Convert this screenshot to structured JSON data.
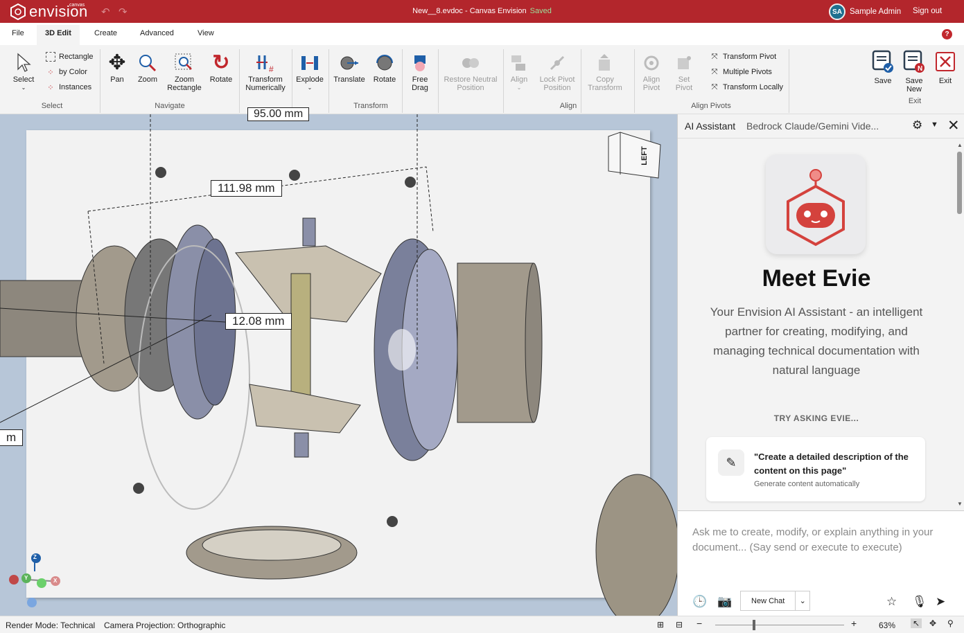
{
  "app": {
    "logo_text": "envision",
    "logo_sup": "canvas",
    "title": "New__8.evdoc - Canvas Envision",
    "saved": "Saved",
    "user_initials": "SA",
    "user_name": "Sample Admin",
    "signout": "Sign out"
  },
  "tabs": [
    "File",
    "3D Edit",
    "Create",
    "Advanced",
    "View"
  ],
  "ribbon": {
    "select": {
      "label": "Select",
      "group": "Select",
      "rectangle": "Rectangle",
      "by_color": "by Color",
      "instances": "Instances"
    },
    "navigate": {
      "group": "Navigate",
      "pan": "Pan",
      "zoom": "Zoom",
      "zoom_rect_1": "Zoom",
      "zoom_rect_2": "Rectangle",
      "rotate": "Rotate"
    },
    "transform": {
      "group": "Transform",
      "numerically_1": "Transform",
      "numerically_2": "Numerically",
      "explode": "Explode",
      "translate": "Translate",
      "rotate": "Rotate",
      "free_drag_1": "Free",
      "free_drag_2": "Drag",
      "restore_1": "Restore Neutral",
      "restore_2": "Position"
    },
    "align": {
      "group": "Align",
      "align": "Align",
      "lock_1": "Lock Pivot",
      "lock_2": "Position",
      "copy_1": "Copy",
      "copy_2": "Transform"
    },
    "align_pivots": {
      "group": "Align Pivots",
      "align_pivot_1": "Align",
      "align_pivot_2": "Pivot",
      "set_pivot_1": "Set",
      "set_pivot_2": "Pivot",
      "transform_pivot": "Transform Pivot",
      "multiple_pivots": "Multiple Pivots",
      "transform_locally": "Transform Locally"
    },
    "exit": {
      "group": "Exit",
      "save": "Save",
      "save_new_1": "Save",
      "save_new_2": "New",
      "exit": "Exit"
    }
  },
  "viewport": {
    "dimensions": [
      "95.00 mm",
      "111.98 mm",
      "12.08 mm",
      "m"
    ],
    "view_cube": "LEFT",
    "axes": [
      "Z",
      "Y",
      "X"
    ]
  },
  "assistant": {
    "title": "AI Assistant",
    "model": "Bedrock Claude/Gemini Vide...",
    "heading": "Meet Evie",
    "description": "Your Envision AI Assistant - an intelligent partner for creating, modifying, and managing technical documentation with natural language",
    "try_label": "TRY ASKING EVIE...",
    "suggestion": "\"Create a detailed description of the content on this page\"",
    "suggestion_sub": "Generate content automatically",
    "placeholder": "Ask me to create, modify, or explain anything in your document... (Say send or execute to execute)",
    "new_chat": "New Chat"
  },
  "status": {
    "render_mode": "Render Mode: Technical",
    "projection": "Camera Projection: Orthographic",
    "zoom": "63%"
  },
  "colors": {
    "brand": "#b3262c",
    "ribbon": "#f3f3f3",
    "viewport": "#b7c6d8"
  }
}
